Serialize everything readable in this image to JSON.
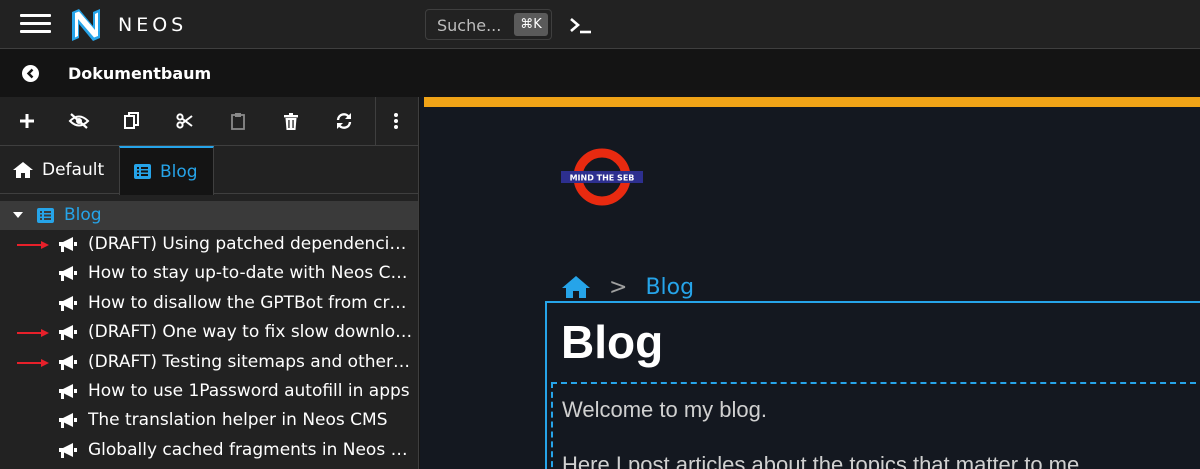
{
  "topbar": {
    "logo_text": "NEOS",
    "search_placeholder": "Suche...",
    "search_shortcut": "⌘K"
  },
  "docbar": {
    "title": "Dokumentbaum"
  },
  "sidebar": {
    "toolbar_icons": [
      "plus-icon",
      "hide-icon",
      "copy-icon",
      "cut-icon",
      "paste-icon",
      "trash-icon",
      "refresh-icon",
      "more-icon"
    ],
    "tabs": [
      {
        "label": "Default",
        "icon": "home-icon"
      },
      {
        "label": "Blog",
        "icon": "list-icon"
      }
    ],
    "tree": {
      "root": "Blog",
      "items": [
        {
          "label": "(DRAFT) Using patched dependencies with Composer",
          "marked": true
        },
        {
          "label": "How to stay up-to-date with Neos CMS",
          "marked": false
        },
        {
          "label": "How to disallow the GPTBot from crawling",
          "marked": false
        },
        {
          "label": "(DRAFT) One way to fix slow downloads",
          "marked": true
        },
        {
          "label": "(DRAFT) Testing sitemaps and other things",
          "marked": true
        },
        {
          "label": "How to use 1Password autofill in apps",
          "marked": false
        },
        {
          "label": "The translation helper in Neos CMS",
          "marked": false
        },
        {
          "label": "Globally cached fragments in Neos CMS",
          "marked": false
        }
      ]
    }
  },
  "content": {
    "logo_text": "MIND THE SEB",
    "breadcrumb_sep": ">",
    "breadcrumb_current": "Blog",
    "page_title": "Blog",
    "paragraph1": "Welcome to my blog.",
    "paragraph2": "Here I post articles about the topics that matter to me."
  },
  "colors": {
    "accent": "#26a4e9",
    "warning": "#f0a317",
    "arrow": "#e8202a"
  }
}
